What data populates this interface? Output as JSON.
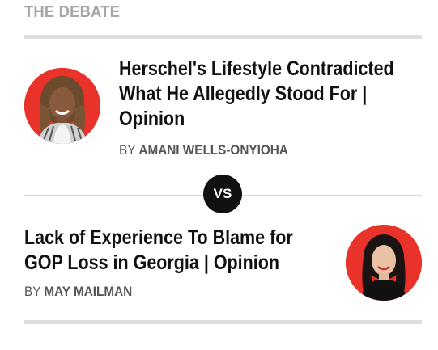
{
  "section": {
    "label": "THE DEBATE"
  },
  "articles": [
    {
      "headline": "Herschel's Lifestyle Contradicted What He Allegedly Stood For | Opinion",
      "by_prefix": "BY",
      "author": "AMANI WELLS-ONYIOHA"
    },
    {
      "headline": "Lack of Experience To Blame for GOP Loss in Georgia | Opinion",
      "by_prefix": "BY",
      "author": "MAY MAILMAN"
    }
  ],
  "versus": {
    "label": "VS"
  },
  "colors": {
    "avatar_background": "#e8322a",
    "section_label": "#a6a6a6",
    "divider": "#dedede",
    "vs_badge": "#111111"
  },
  "icons": {
    "avatar_1": "author-photo-avatar",
    "avatar_2": "author-photo-avatar"
  }
}
